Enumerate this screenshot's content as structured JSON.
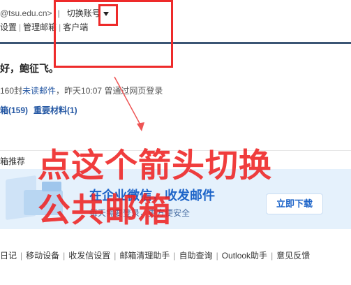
{
  "header": {
    "email_domain": "@tsu.edu.cn>",
    "separator": "|",
    "switch_account": "切换账号",
    "links": [
      "设置",
      "管理邮箱",
      "客户端"
    ]
  },
  "greeting": "好，鲍征飞。",
  "unread": {
    "count_text": "160封",
    "unread_link": "未读邮件",
    "login_info": "，昨天10:07 曾通过网页登录"
  },
  "folders": [
    "箱(159)",
    "重要材料(1)"
  ],
  "recommend": {
    "title": "箱推荐",
    "banner_title": "在企业微信，收发邮件",
    "banner_sub": "每天需要登录，更方便安全",
    "download_button": "立即下载"
  },
  "footer_links": [
    "日记",
    "移动设备",
    "收发信设置",
    "邮箱清理助手",
    "自助查询",
    "Outlook助手",
    "意见反馈"
  ],
  "annotation": {
    "line1": "点这个箭头切换",
    "line2": "公共邮箱",
    "color": "#ee2222"
  }
}
